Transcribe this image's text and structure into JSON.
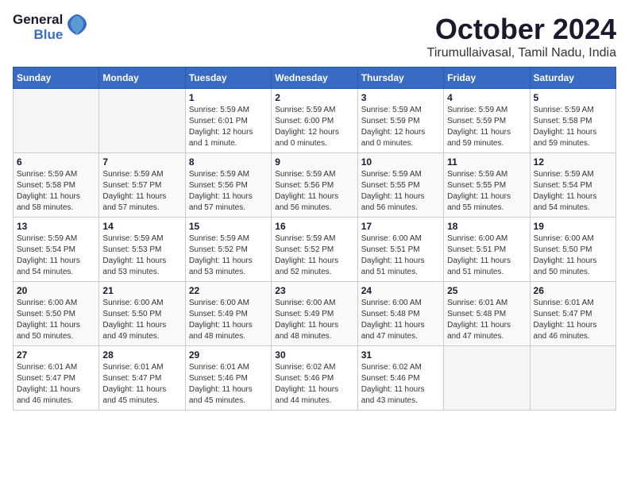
{
  "logo": {
    "line1": "General",
    "line2": "Blue"
  },
  "title": "October 2024",
  "location": "Tirumullaivasal, Tamil Nadu, India",
  "days_of_week": [
    "Sunday",
    "Monday",
    "Tuesday",
    "Wednesday",
    "Thursday",
    "Friday",
    "Saturday"
  ],
  "weeks": [
    [
      {
        "day": "",
        "info": ""
      },
      {
        "day": "",
        "info": ""
      },
      {
        "day": "1",
        "info": "Sunrise: 5:59 AM\nSunset: 6:01 PM\nDaylight: 12 hours\nand 1 minute."
      },
      {
        "day": "2",
        "info": "Sunrise: 5:59 AM\nSunset: 6:00 PM\nDaylight: 12 hours\nand 0 minutes."
      },
      {
        "day": "3",
        "info": "Sunrise: 5:59 AM\nSunset: 5:59 PM\nDaylight: 12 hours\nand 0 minutes."
      },
      {
        "day": "4",
        "info": "Sunrise: 5:59 AM\nSunset: 5:59 PM\nDaylight: 11 hours\nand 59 minutes."
      },
      {
        "day": "5",
        "info": "Sunrise: 5:59 AM\nSunset: 5:58 PM\nDaylight: 11 hours\nand 59 minutes."
      }
    ],
    [
      {
        "day": "6",
        "info": "Sunrise: 5:59 AM\nSunset: 5:58 PM\nDaylight: 11 hours\nand 58 minutes."
      },
      {
        "day": "7",
        "info": "Sunrise: 5:59 AM\nSunset: 5:57 PM\nDaylight: 11 hours\nand 57 minutes."
      },
      {
        "day": "8",
        "info": "Sunrise: 5:59 AM\nSunset: 5:56 PM\nDaylight: 11 hours\nand 57 minutes."
      },
      {
        "day": "9",
        "info": "Sunrise: 5:59 AM\nSunset: 5:56 PM\nDaylight: 11 hours\nand 56 minutes."
      },
      {
        "day": "10",
        "info": "Sunrise: 5:59 AM\nSunset: 5:55 PM\nDaylight: 11 hours\nand 56 minutes."
      },
      {
        "day": "11",
        "info": "Sunrise: 5:59 AM\nSunset: 5:55 PM\nDaylight: 11 hours\nand 55 minutes."
      },
      {
        "day": "12",
        "info": "Sunrise: 5:59 AM\nSunset: 5:54 PM\nDaylight: 11 hours\nand 54 minutes."
      }
    ],
    [
      {
        "day": "13",
        "info": "Sunrise: 5:59 AM\nSunset: 5:54 PM\nDaylight: 11 hours\nand 54 minutes."
      },
      {
        "day": "14",
        "info": "Sunrise: 5:59 AM\nSunset: 5:53 PM\nDaylight: 11 hours\nand 53 minutes."
      },
      {
        "day": "15",
        "info": "Sunrise: 5:59 AM\nSunset: 5:52 PM\nDaylight: 11 hours\nand 53 minutes."
      },
      {
        "day": "16",
        "info": "Sunrise: 5:59 AM\nSunset: 5:52 PM\nDaylight: 11 hours\nand 52 minutes."
      },
      {
        "day": "17",
        "info": "Sunrise: 6:00 AM\nSunset: 5:51 PM\nDaylight: 11 hours\nand 51 minutes."
      },
      {
        "day": "18",
        "info": "Sunrise: 6:00 AM\nSunset: 5:51 PM\nDaylight: 11 hours\nand 51 minutes."
      },
      {
        "day": "19",
        "info": "Sunrise: 6:00 AM\nSunset: 5:50 PM\nDaylight: 11 hours\nand 50 minutes."
      }
    ],
    [
      {
        "day": "20",
        "info": "Sunrise: 6:00 AM\nSunset: 5:50 PM\nDaylight: 11 hours\nand 50 minutes."
      },
      {
        "day": "21",
        "info": "Sunrise: 6:00 AM\nSunset: 5:50 PM\nDaylight: 11 hours\nand 49 minutes."
      },
      {
        "day": "22",
        "info": "Sunrise: 6:00 AM\nSunset: 5:49 PM\nDaylight: 11 hours\nand 48 minutes."
      },
      {
        "day": "23",
        "info": "Sunrise: 6:00 AM\nSunset: 5:49 PM\nDaylight: 11 hours\nand 48 minutes."
      },
      {
        "day": "24",
        "info": "Sunrise: 6:00 AM\nSunset: 5:48 PM\nDaylight: 11 hours\nand 47 minutes."
      },
      {
        "day": "25",
        "info": "Sunrise: 6:01 AM\nSunset: 5:48 PM\nDaylight: 11 hours\nand 47 minutes."
      },
      {
        "day": "26",
        "info": "Sunrise: 6:01 AM\nSunset: 5:47 PM\nDaylight: 11 hours\nand 46 minutes."
      }
    ],
    [
      {
        "day": "27",
        "info": "Sunrise: 6:01 AM\nSunset: 5:47 PM\nDaylight: 11 hours\nand 46 minutes."
      },
      {
        "day": "28",
        "info": "Sunrise: 6:01 AM\nSunset: 5:47 PM\nDaylight: 11 hours\nand 45 minutes."
      },
      {
        "day": "29",
        "info": "Sunrise: 6:01 AM\nSunset: 5:46 PM\nDaylight: 11 hours\nand 45 minutes."
      },
      {
        "day": "30",
        "info": "Sunrise: 6:02 AM\nSunset: 5:46 PM\nDaylight: 11 hours\nand 44 minutes."
      },
      {
        "day": "31",
        "info": "Sunrise: 6:02 AM\nSunset: 5:46 PM\nDaylight: 11 hours\nand 43 minutes."
      },
      {
        "day": "",
        "info": ""
      },
      {
        "day": "",
        "info": ""
      }
    ]
  ]
}
